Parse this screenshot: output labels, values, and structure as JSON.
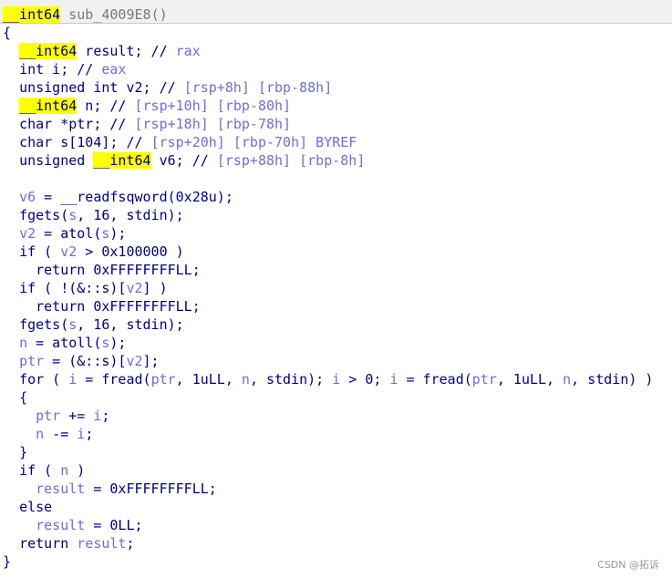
{
  "window": {
    "title_highlight": "__int64",
    "title_rest": " sub_4009E8"
  },
  "code": {
    "brace_open": "{",
    "brace_close": "}",
    "decl_result_type": "__int64",
    "decl_result": " result; // ",
    "decl_result_reg": "rax",
    "decl_i": "int i; // ",
    "decl_i_reg": "eax",
    "decl_v2": "unsigned int v2; // ",
    "decl_v2_reg": "[rsp+8h] [rbp-88h]",
    "decl_n_type": "__int64",
    "decl_n": " n; // ",
    "decl_n_reg": "[rsp+10h] [rbp-80h]",
    "decl_ptr": "char *ptr; // ",
    "decl_ptr_reg": "[rsp+18h] [rbp-78h]",
    "decl_s": "char s[104]; // ",
    "decl_s_reg": "[rsp+20h] [rbp-70h] BYREF",
    "decl_v6_pre": "unsigned ",
    "decl_v6_type": "__int64",
    "decl_v6": " v6; // ",
    "decl_v6_reg": "[rsp+88h] [rbp-8h]",
    "l1_var": "v6",
    "l1_rest": " = __readfsqword(0x28u);",
    "l2a": "fgets(",
    "l2_s": "s",
    "l2b": ", 16, stdin);",
    "l3_var": "v2",
    "l3a": " = atol(",
    "l3_s": "s",
    "l3b": ");",
    "l4a": "if ( ",
    "l4_v2": "v2",
    "l4b": " > 0x100000 )",
    "l5": "return 0xFFFFFFFFLL;",
    "l6a": "if ( !(&::s)[",
    "l6_v2": "v2",
    "l6b": "] )",
    "l7": "return 0xFFFFFFFFLL;",
    "l8a": "fgets(",
    "l8_s": "s",
    "l8b": ", 16, stdin);",
    "l9_var": "n",
    "l9a": " = atoll(",
    "l9_s": "s",
    "l9b": ");",
    "l10_var": "ptr",
    "l10a": " = (&::s)[",
    "l10_v2": "v2",
    "l10b": "];",
    "l11a": "for ( ",
    "l11_i1": "i",
    "l11b": " = fread(",
    "l11_ptr1": "ptr",
    "l11c": ", 1uLL, ",
    "l11_n1": "n",
    "l11d": ", stdin); ",
    "l11_i2": "i",
    "l11e": " > 0; ",
    "l11_i3": "i",
    "l11f": " = fread(",
    "l11_ptr2": "ptr",
    "l11g": ", 1uLL, ",
    "l11_n2": "n",
    "l11h": ", stdin) )",
    "l12": "{",
    "l13_ptr": "ptr",
    "l13a": " += ",
    "l13_i": "i",
    "l13b": ";",
    "l14_n": "n",
    "l14a": " -= ",
    "l14_i": "i",
    "l14b": ";",
    "l15": "}",
    "l16a": "if ( ",
    "l16_n": "n",
    "l16b": " )",
    "l17_r": "result",
    "l17a": " = 0xFFFFFFFFLL;",
    "l18": "else",
    "l19_r": "result",
    "l19a": " = 0LL;",
    "l20a": "return ",
    "l20_r": "result",
    "l20b": ";"
  },
  "watermark": "CSDN @拓诉"
}
